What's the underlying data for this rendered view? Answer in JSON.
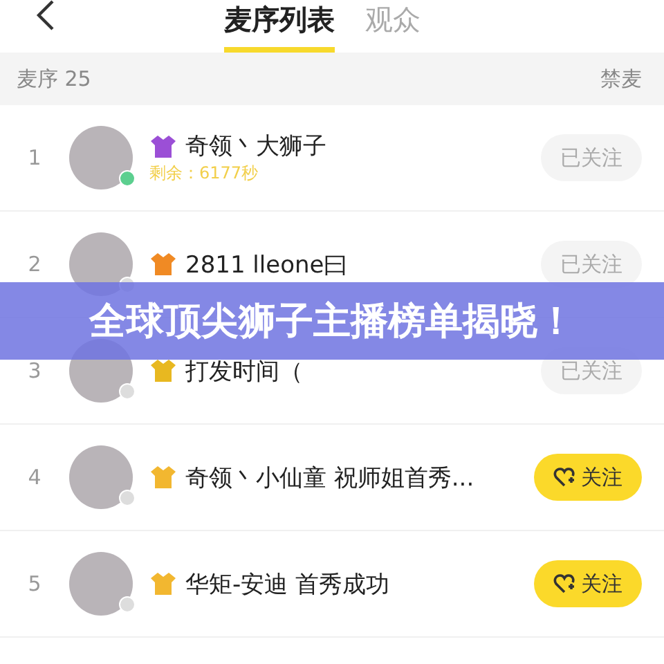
{
  "tabs": [
    {
      "label": "麦序列表",
      "selected": true
    },
    {
      "label": "观众",
      "selected": false
    }
  ],
  "section": {
    "title": "麦序 25",
    "action": "禁麦"
  },
  "rows": [
    {
      "rank": "1",
      "name": "奇领丶大狮子",
      "subtitle": "剩余：6177秒",
      "online": true,
      "color": "#9b4fd6",
      "followed": true,
      "button": "已关注"
    },
    {
      "rank": "2",
      "name": "2811 lleone曰",
      "online": false,
      "color": "#f08a24",
      "followed": true,
      "button": "已关注"
    },
    {
      "rank": "3",
      "name": "打发时间（",
      "online": false,
      "color": "#e8b820",
      "followed": true,
      "button": "已关注"
    },
    {
      "rank": "4",
      "name": "奇领丶小仙童 祝师姐首秀...",
      "online": false,
      "color": "#f2b730",
      "followed": false,
      "button": "关注"
    },
    {
      "rank": "5",
      "name": "华矩-安迪  首秀成功",
      "online": false,
      "color": "#f2b730",
      "followed": false,
      "button": "关注"
    }
  ],
  "banner": {
    "text": "全球顶尖狮子主播榜单揭晓！"
  }
}
